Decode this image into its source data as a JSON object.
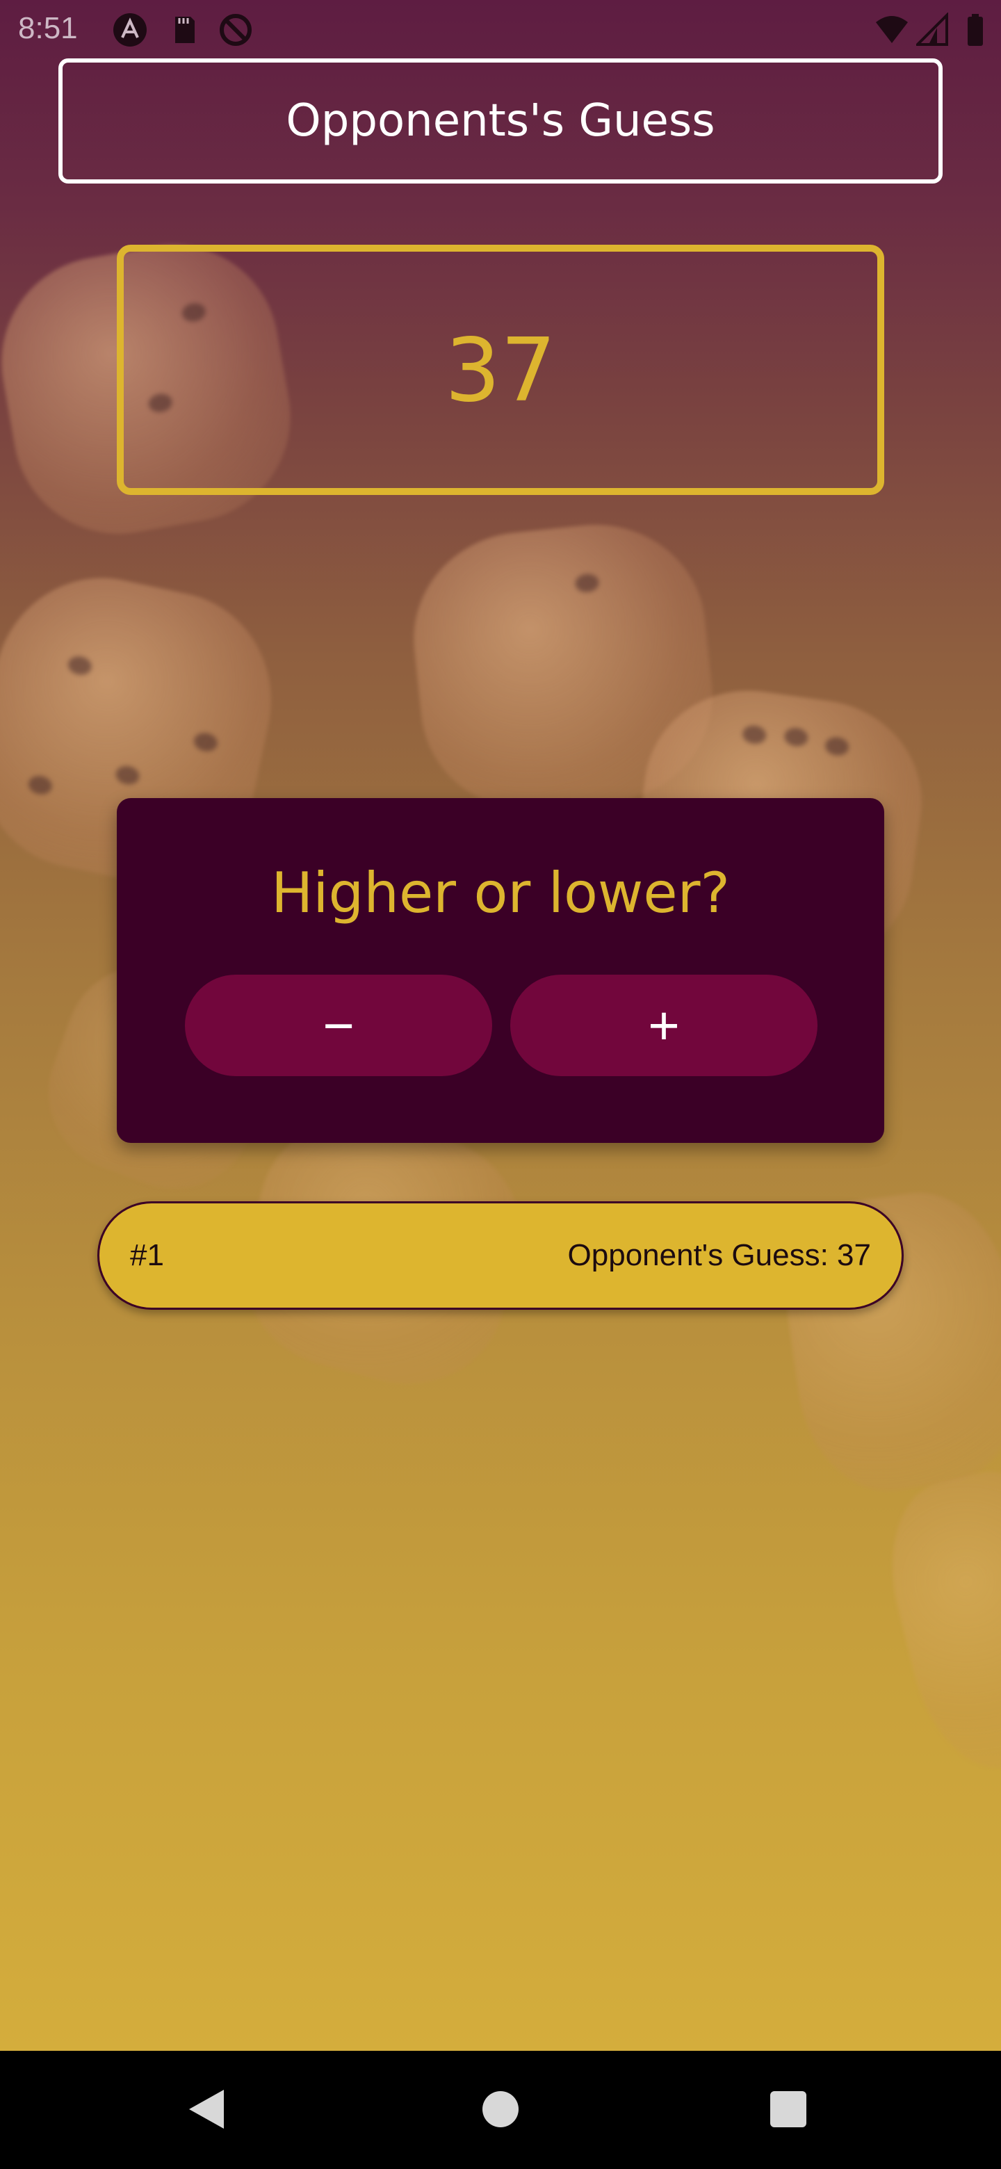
{
  "status_bar": {
    "time": "8:51",
    "left_icons": [
      "app-a-icon",
      "sd-card-icon",
      "no-sync-icon"
    ],
    "right_icons": [
      "wifi-icon",
      "signal-icon",
      "battery-icon"
    ]
  },
  "header": {
    "title": "Opponents's Guess"
  },
  "guess": {
    "number": "37"
  },
  "prompt_card": {
    "title": "Higher or lower?",
    "minus_label": "−",
    "plus_label": "+"
  },
  "guess_log": [
    {
      "round": "#1",
      "text": "Opponent's Guess: 37"
    }
  ],
  "colors": {
    "accent": "#ddb52f",
    "card_bg": "#3b0026",
    "button_bg": "#72063c"
  },
  "nav_bar": {
    "icons": [
      "back-icon",
      "home-icon",
      "recents-icon"
    ]
  }
}
